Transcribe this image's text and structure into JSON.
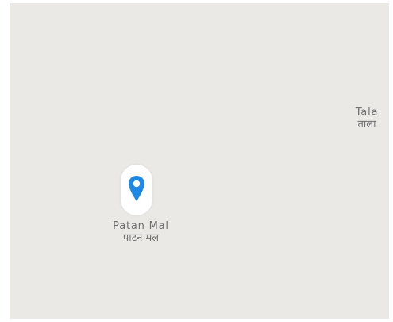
{
  "map": {
    "background_color": "#ebe9e6",
    "pin_color": "#1e88e5",
    "pin_icon": "location-pin-icon",
    "places": {
      "tala": {
        "name_latin": "Tala",
        "name_devanagari": "ताला"
      },
      "patan_mal": {
        "name_latin": "Patan Mal",
        "name_devanagari": "पाटन मल"
      }
    }
  }
}
